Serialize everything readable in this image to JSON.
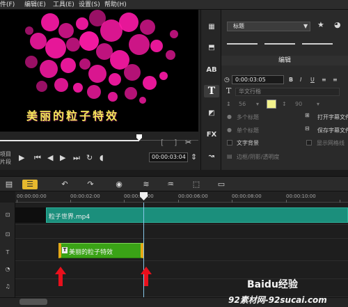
{
  "menu": {
    "file": "件(F)",
    "edit": "编辑(E)",
    "tools": "工具(E)",
    "settings": "设置(S)",
    "help": "帮助(H)"
  },
  "preview": {
    "caption": "美丽的粒子特效",
    "timecode": "00:00:03:04",
    "side_label_top": "项目",
    "side_label_bottom": "片段"
  },
  "options": {
    "title_dropdown": "标题",
    "header": "编辑",
    "duration": "0:00:03:05",
    "font_name": "华文行楷",
    "font_size": "56",
    "color_hex": "#f2f28c",
    "line_spacing": "90",
    "multi_title": "多个标题",
    "single_title": "单个标题",
    "text_background": "文字背景",
    "open_subtitle": "打开字幕文件",
    "save_subtitle": "保存字幕文件",
    "show_grid": "显示网格线",
    "border_shadow": "边框/阴影/透明度"
  },
  "timeline": {
    "ruler": [
      "00:00:00:00",
      "00:00:02:00",
      "00:00:04:00",
      "00:00:06:00",
      "00:00:08:00",
      "00:00:10:00"
    ],
    "video_clip": "粒子世界.mp4",
    "title_clip": "美丽的粒子特效"
  },
  "colors": {
    "particle": "#ff1aa8",
    "caption": "#f4e65a",
    "video_clip": "#1b8f7c",
    "title_clip": "#3aa316",
    "clip_handle": "#e6a817",
    "arrow": "#e8101c",
    "playhead": "#87c7e8"
  },
  "icons": [
    "menu-icon",
    "play-icon",
    "skip-start-icon",
    "prev-frame-icon",
    "next-frame-icon",
    "skip-end-icon",
    "repeat-icon",
    "volume-icon",
    "title-icon",
    "effects-icon",
    "transition-icon",
    "undo-icon",
    "redo-icon",
    "record-icon",
    "audio-wave-icon",
    "mixer-icon",
    "subtitle-icon",
    "star-icon",
    "palette-icon"
  ],
  "watermark": {
    "logo": "Baidu经验",
    "site": "92素材网-92sucai.com"
  }
}
